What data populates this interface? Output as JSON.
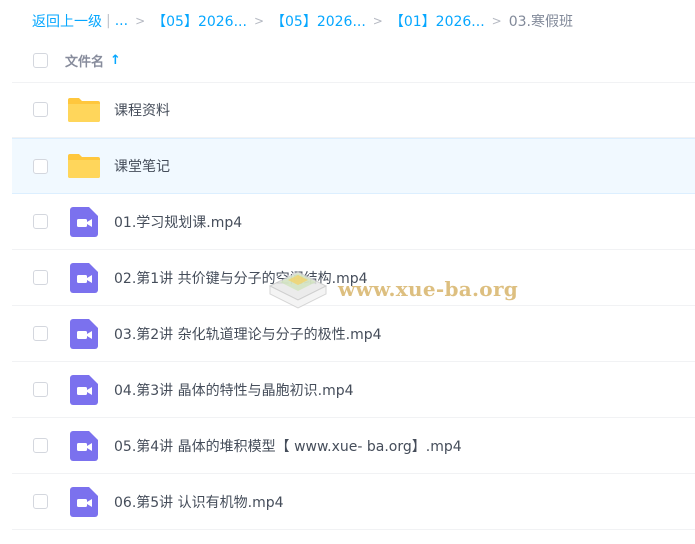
{
  "breadcrumb": {
    "back_label": "返回上一级",
    "separator_bar": "|",
    "ellipsis": "...",
    "items": [
      "【05】2026...",
      "【05】2026...",
      "【01】2026..."
    ],
    "current": "03.寒假班",
    "chevron": ">"
  },
  "header": {
    "column_name": "文件名",
    "sort_arrow": "↑"
  },
  "files": [
    {
      "name": "课程资料",
      "type": "folder"
    },
    {
      "name": "课堂笔记",
      "type": "folder"
    },
    {
      "name": "01.学习规划课.mp4",
      "type": "video"
    },
    {
      "name": "02.第1讲 共价键与分子的空间结构.mp4",
      "type": "video"
    },
    {
      "name": "03.第2讲 杂化轨道理论与分子的极性.mp4",
      "type": "video"
    },
    {
      "name": "04.第3讲 晶体的特性与晶胞初识.mp4",
      "type": "video"
    },
    {
      "name": "05.第4讲 晶体的堆积模型【 www.xue- ba.org】.mp4",
      "type": "video"
    },
    {
      "name": "06.第5讲 认识有机物.mp4",
      "type": "video"
    }
  ],
  "watermark": {
    "text": "www.xue-ba.org"
  },
  "colors": {
    "accent": "#06a7ff",
    "folder": "#ffd04b",
    "video": "#7b71ee",
    "hover_row": "#f1f9ff"
  }
}
